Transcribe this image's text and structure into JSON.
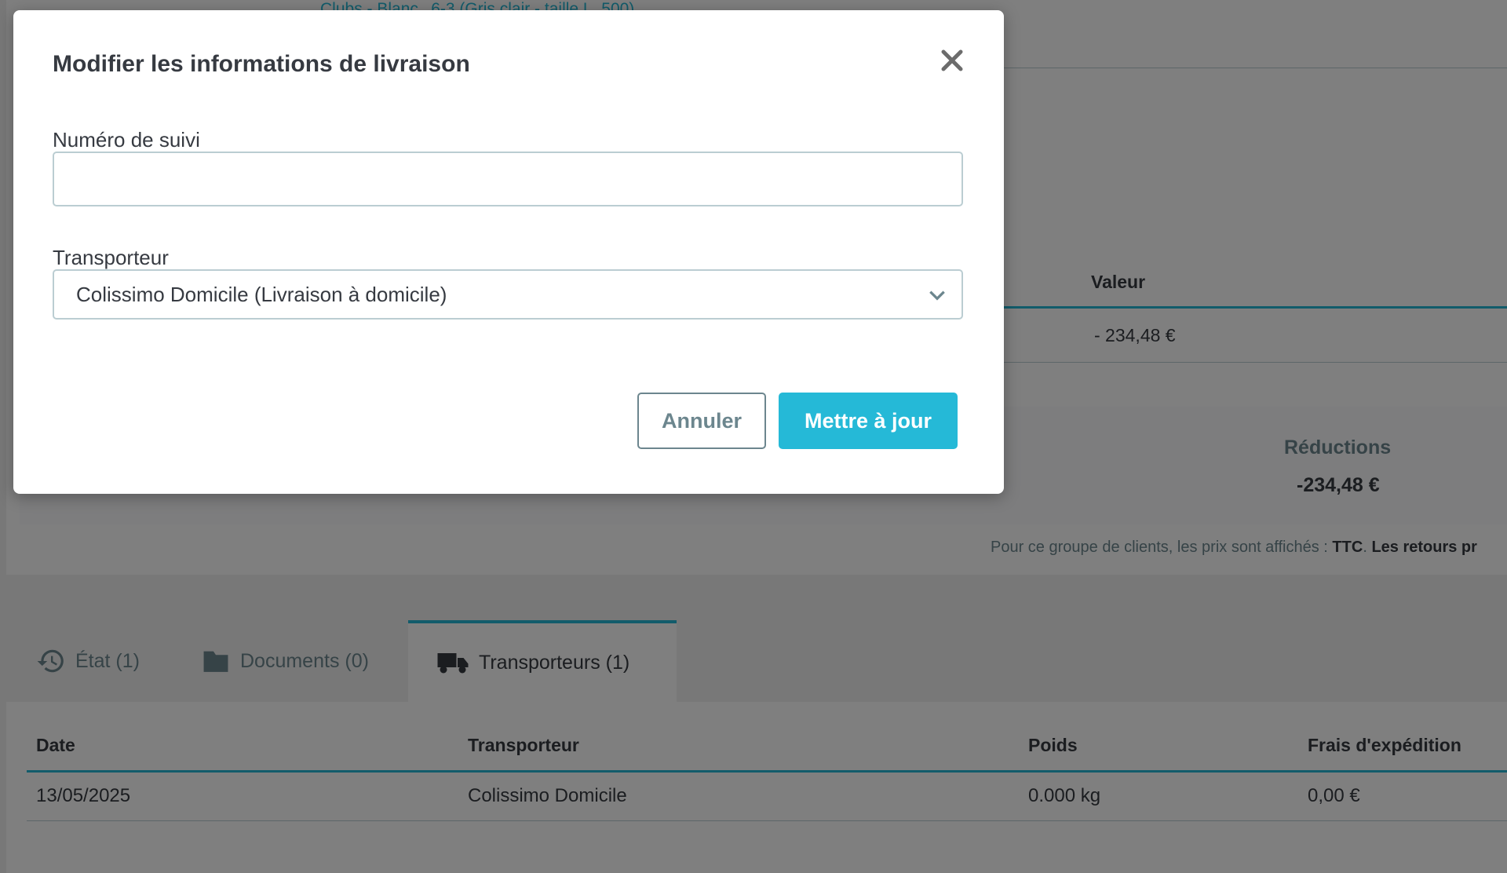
{
  "background": {
    "top_link": "Clubs - Blanc ‚ 6-3 (Gris clair - taille L, 500)",
    "discounts": {
      "header": "Valeur",
      "value": "- 234,48 €"
    },
    "totals": {
      "reductions_label": "Réductions",
      "reductions_value": "-234,48 €"
    },
    "note": {
      "prefix": "Pour ce groupe de clients, les prix sont affichés : ",
      "tax_mode": "TTC",
      "sep": ". ",
      "suffix": "Les retours pr"
    }
  },
  "tabs": [
    {
      "label": "État (1)",
      "icon": "history-icon"
    },
    {
      "label": "Documents (0)",
      "icon": "folder-icon"
    },
    {
      "label": "Transporteurs (1)",
      "icon": "truck-icon",
      "active": true
    }
  ],
  "carriers_table": {
    "headers": [
      "Date",
      "Transporteur",
      "Poids",
      "Frais d'expédition"
    ],
    "rows": [
      [
        "13/05/2025",
        "Colissimo Domicile",
        "0.000 kg",
        "0,00 €"
      ]
    ]
  },
  "modal": {
    "title": "Modifier les informations de livraison",
    "close_icon": "close-icon",
    "tracking_label": "Numéro de suivi",
    "tracking_value": "",
    "carrier_label": "Transporteur",
    "carrier_selected": "Colissimo Domicile (Livraison à domicile)",
    "cancel_label": "Annuler",
    "update_label": "Mettre à jour"
  },
  "colors": {
    "accent": "#25b9d7",
    "text": "#363a41",
    "muted": "#6c868e",
    "overlay": "rgba(0,0,0,0.5)"
  }
}
